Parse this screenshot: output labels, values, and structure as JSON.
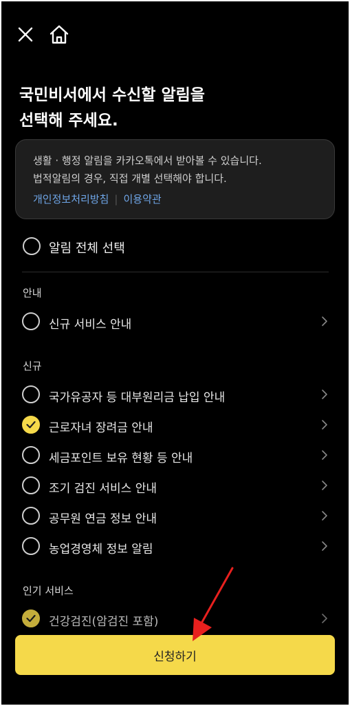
{
  "header": {
    "close_icon": "close-icon",
    "home_icon": "home-icon"
  },
  "title": "국민비서에서 수신할 알림을\n선택해 주세요.",
  "notice": {
    "line1": "생활 · 행정 알림을 카카오톡에서 받아볼 수 있습니다.",
    "line2": "법적알림의 경우, 직접 개별 선택해야 합니다.",
    "privacy_link": "개인정보처리방침",
    "separator": "|",
    "terms_link": "이용약관"
  },
  "select_all": {
    "label": "알림 전체 선택",
    "checked": false
  },
  "sections": [
    {
      "title": "안내",
      "items": [
        {
          "label": "신규 서비스 안내",
          "checked": false
        }
      ]
    },
    {
      "title": "신규",
      "items": [
        {
          "label": "국가유공자 등 대부원리금 납입 안내",
          "checked": false
        },
        {
          "label": "근로자녀 장려금 안내",
          "checked": true
        },
        {
          "label": "세금포인트 보유 현황 등 안내",
          "checked": false
        },
        {
          "label": "조기 검진 서비스 안내",
          "checked": false
        },
        {
          "label": "공무원 연금 정보 안내",
          "checked": false
        },
        {
          "label": "농업경영체 정보 알림",
          "checked": false
        }
      ]
    },
    {
      "title": "인기 서비스",
      "items": [
        {
          "label": "건강검진(암검진 포함)",
          "checked": true
        }
      ]
    }
  ],
  "apply_button": "신청하기",
  "colors": {
    "background": "#000000",
    "accent": "#f5d94a",
    "link": "#6fa6e8",
    "arrow": "#e8201e"
  }
}
